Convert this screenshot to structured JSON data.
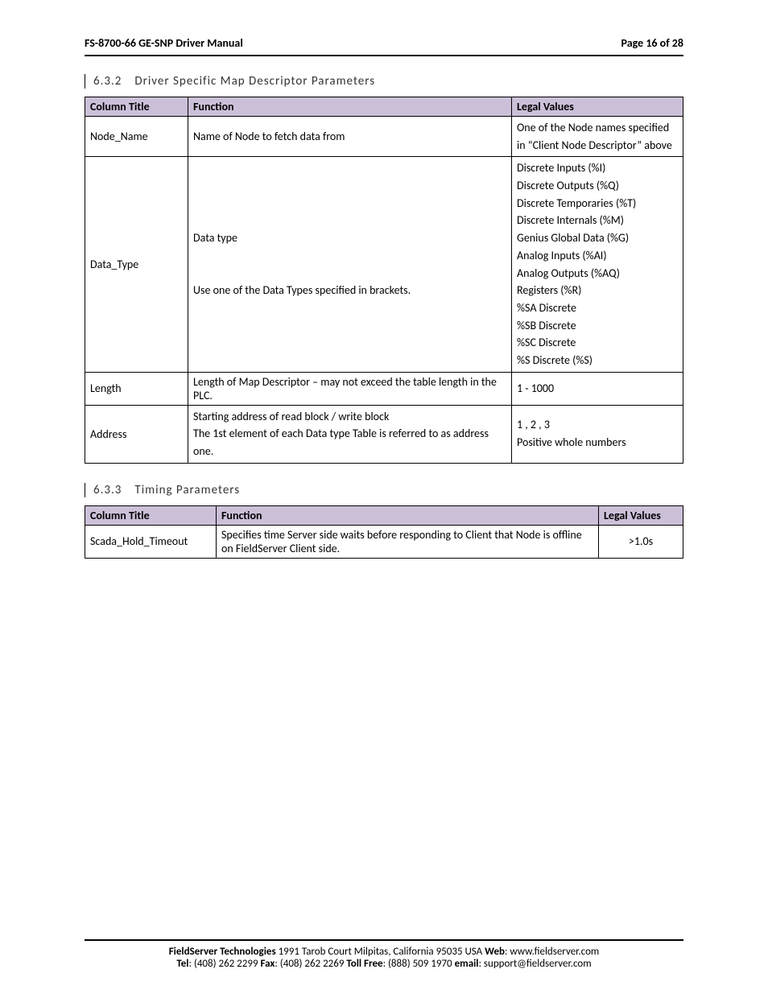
{
  "header": {
    "title": "FS-8700-66 GE-SNP Driver Manual",
    "page": "Page 16 of 28"
  },
  "section1": {
    "num": "6.3.2",
    "title": "Driver Specific Map Descriptor Parameters",
    "headers": {
      "c1": "Column Title",
      "c2": "Function",
      "c3": "Legal Values"
    },
    "rows": [
      {
        "title": "Node_Name",
        "func": "Name of Node to fetch data from",
        "legal": "One of the Node names specified in “Client Node Descriptor” above"
      },
      {
        "title": "Data_Type",
        "func": "Data type\n\nUse one of the Data Types specified in brackets.",
        "legal": "Discrete Inputs (%I)\nDiscrete Outputs (%Q)\nDiscrete Temporaries (%T)\nDiscrete Internals (%M)\nGenius Global Data (%G)\nAnalog Inputs (%AI)\nAnalog Outputs (%AQ)\nRegisters (%R)\n%SA Discrete\n%SB Discrete\n%SC Discrete\n%S Discrete (%S)"
      },
      {
        "title": "Length",
        "func": "Length of Map Descriptor – may not exceed the table length in the PLC.",
        "legal": "1 - 1000"
      },
      {
        "title": "Address",
        "func": "Starting address of read block / write block\nThe 1st element of each Data type Table is referred to as address one.",
        "legal": "1 , 2 , 3\nPositive whole numbers"
      }
    ]
  },
  "section2": {
    "num": "6.3.3",
    "title": "Timing Parameters",
    "headers": {
      "c1": "Column Title",
      "c2": "Function",
      "c3": "Legal Values"
    },
    "rows": [
      {
        "title": "Scada_Hold_Timeout",
        "func": "Specifies time Server side waits before responding to Client that Node is offline on FieldServer Client side.",
        "legal": ">1.0s"
      }
    ]
  },
  "footer": {
    "line1_a": "FieldServer Technologies",
    "line1_b": " 1991 Tarob Court Milpitas, California 95035 USA  ",
    "line1_c": "Web",
    "line1_d": ": www.fieldserver.com",
    "line2_a": "Tel",
    "line2_b": ": (408) 262 2299  ",
    "line2_c": "Fax",
    "line2_d": ": (408) 262 2269  ",
    "line2_e": "Toll Free",
    "line2_f": ": (888) 509 1970  ",
    "line2_g": "email",
    "line2_h": ": support@fieldserver.com"
  }
}
